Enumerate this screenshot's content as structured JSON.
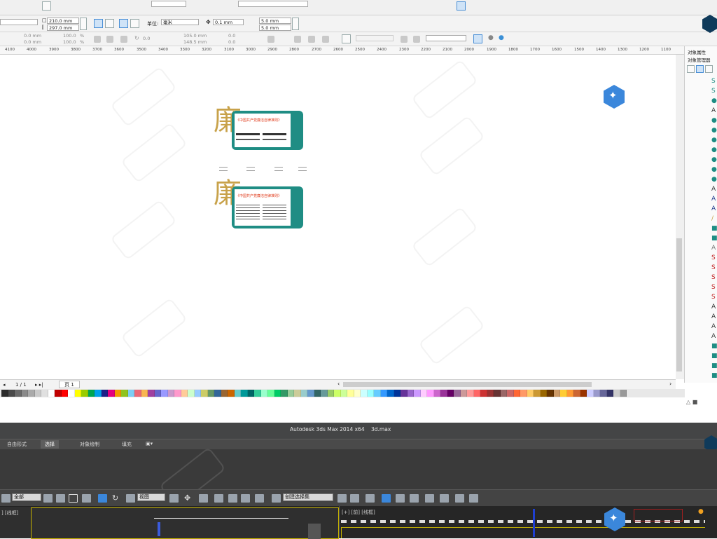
{
  "app": {
    "window_title_parts": [
      "Autodesk 3ds Max  2014 x64",
      "3d.max"
    ]
  },
  "property_bar": {
    "width_value": "210.0 mm",
    "height_value": "297.0 mm",
    "units_label": "单位:",
    "units_value": "毫米",
    "nudge_value": "0.1 mm",
    "dup_x_value": "5.0 mm",
    "dup_y_value": "5.0 mm"
  },
  "toolbar2": {
    "pos_x": "0.0 mm",
    "pos_y": "0.0 mm",
    "scale_x": "100.0",
    "scale_y": "100.0",
    "percent_sign": "%",
    "rotation": "0.0",
    "center_x": "105.0 mm",
    "center_y": "148.5 mm",
    "skew_x": "0.0",
    "skew_y": "0.0"
  },
  "ruler": {
    "ticks": [
      "4100",
      "4000",
      "3900",
      "3800",
      "3700",
      "3600",
      "3500",
      "3400",
      "3300",
      "3200",
      "3100",
      "3000",
      "2900",
      "2800",
      "2700",
      "2600",
      "2500",
      "2400",
      "2300",
      "2200",
      "2100",
      "2000",
      "1900",
      "1800",
      "1700",
      "1600",
      "1500",
      "1400",
      "1300",
      "1200",
      "1100"
    ]
  },
  "docker": {
    "title1": "对象属性",
    "title2": "对象管理器"
  },
  "status": {
    "page_counter": "1 / 1",
    "page_tab": "页 1"
  },
  "palette": [
    "#2b2b2b",
    "#4a4a4a",
    "#6a6a6a",
    "#8a8a8a",
    "#aaaaaa",
    "#cacaca",
    "#e0e0e0",
    "#ffffff",
    "#c00000",
    "#ff0000",
    "#ffffff",
    "#ffff00",
    "#99cc00",
    "#00a651",
    "#00a0e9",
    "#1d2088",
    "#e4007f",
    "#f39800",
    "#8fc31f",
    "#7ecef4",
    "#eb6877",
    "#f8b551",
    "#a040a0",
    "#6666cc",
    "#9999ff",
    "#cc99cc",
    "#ff99cc",
    "#ffcc99",
    "#ccffcc",
    "#99ccff",
    "#cccc66",
    "#669966",
    "#336699",
    "#996633",
    "#cc6600",
    "#66cccc",
    "#009999",
    "#006666",
    "#33cc99",
    "#99ffcc",
    "#66ff99",
    "#00cc66",
    "#339966",
    "#99cc99",
    "#cccc99",
    "#99cccc",
    "#6699cc",
    "#336666",
    "#669999",
    "#99cc66",
    "#ccff66",
    "#ccff99",
    "#ffff99",
    "#ffffcc",
    "#ccffff",
    "#99ffff",
    "#66ccff",
    "#3399ff",
    "#0066cc",
    "#003399",
    "#663399",
    "#9966cc",
    "#cc99ff",
    "#ffccff",
    "#ff99ff",
    "#cc66cc",
    "#993399",
    "#660066",
    "#996699",
    "#cc9999",
    "#ff9999",
    "#ff6666",
    "#cc3333",
    "#993333",
    "#663333",
    "#996666",
    "#cc6666",
    "#ff6633",
    "#ff9966",
    "#ffcc66",
    "#cc9933",
    "#996600",
    "#663300",
    "#cc9966",
    "#ffcc33",
    "#ff9933",
    "#cc6633",
    "#993300",
    "#ccccff",
    "#9999cc",
    "#666699",
    "#333366",
    "#cccccc",
    "#999999"
  ],
  "max": {
    "tabs": [
      "自由形式",
      "选择",
      "对象绘制",
      "填充"
    ],
    "sel_all": "全部",
    "view_select": "视图",
    "named_selection": "创建选择集"
  },
  "viewports": {
    "left_label": "] [线框]",
    "right_label": "[+] [前] [线框]"
  },
  "cards": {
    "title1": "《中国共产党廉洁自律准则》",
    "title2": "《中国共产党廉洁自律准则》",
    "seal_char": "廉"
  }
}
